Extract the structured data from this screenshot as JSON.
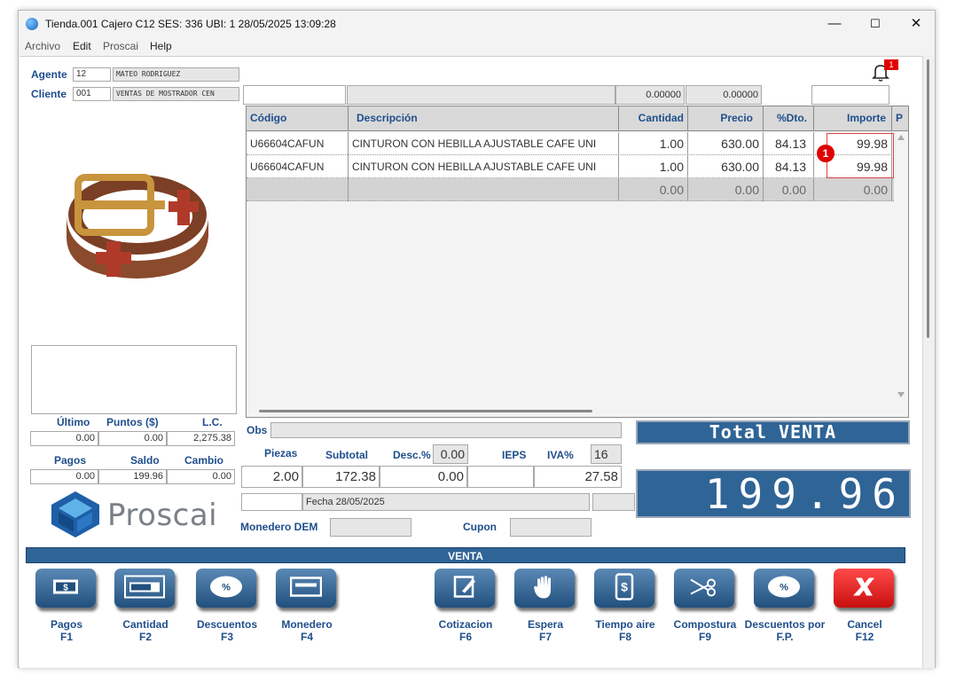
{
  "window": {
    "title": "Tienda.001  Cajero C12     SES: 336   UBI: 1   28/05/2025 13:09:28",
    "controls": {
      "minimize": "—",
      "maximize": "☐",
      "close": "✕"
    }
  },
  "menu": {
    "items": [
      "Archivo",
      "Edit",
      "Proscai",
      "Help"
    ]
  },
  "notification": {
    "count": "1"
  },
  "agent": {
    "label": "Agente",
    "code": "12",
    "name": "MATEO RODRIGUEZ"
  },
  "client": {
    "label": "Cliente",
    "code": "001",
    "name": "VENTAS DE MOSTRADOR CEN"
  },
  "grid_filters": {
    "qty_total": "0.00000",
    "price_total": "0.00000"
  },
  "grid": {
    "headers": [
      "Código",
      "Descripción",
      "Cantidad",
      "Precio",
      "%Dto.",
      "Importe",
      "P"
    ],
    "rows": [
      {
        "codigo": "U66604CAFUN",
        "descripcion": "CINTURON CON HEBILLA AJUSTABLE CAFE UNI",
        "cantidad": "1.00",
        "precio": "630.00",
        "dto": "84.13",
        "importe": "99.98"
      },
      {
        "codigo": "U66604CAFUN",
        "descripcion": "CINTURON CON HEBILLA AJUSTABLE CAFE UNI",
        "cantidad": "1.00",
        "precio": "630.00",
        "dto": "84.13",
        "importe": "99.98"
      }
    ],
    "totals": {
      "cantidad": "0.00",
      "precio": "0.00",
      "dto": "0.00",
      "importe": "0.00"
    },
    "badge": "1"
  },
  "points": {
    "headers": [
      "Último",
      "Puntos ($)",
      "L.C."
    ],
    "values": [
      "0.00",
      "0.00",
      "2,275.38"
    ],
    "headers2": [
      "Pagos",
      "Saldo",
      "Cambio"
    ],
    "values2": [
      "0.00",
      "199.96",
      "0.00"
    ]
  },
  "logo": {
    "text": "Proscai"
  },
  "summary": {
    "obs_label": "Obs",
    "piezas_label": "Piezas",
    "piezas": "2.00",
    "subtotal_label": "Subtotal",
    "subtotal": "172.38",
    "desc_label": "Desc.%",
    "desc_pct": "0.00",
    "desc": "0.00",
    "ieps_label": "IEPS",
    "ieps": "",
    "iva_label": "IVA%",
    "iva_pct": "16",
    "iva": "27.58",
    "fecha": "Fecha 28/05/2025",
    "monedero_label": "Monedero DEM",
    "cupon_label": "Cupon"
  },
  "total": {
    "label": "Total VENTA",
    "value": "199.96"
  },
  "mode_bar": "VENTA",
  "buttons": [
    {
      "label": "Pagos",
      "key": "F1",
      "icon": "cash-icon"
    },
    {
      "label": "Cantidad",
      "key": "F2",
      "icon": "calculator-icon"
    },
    {
      "label": "Descuentos",
      "key": "F3",
      "icon": "discount-icon"
    },
    {
      "label": "Monedero",
      "key": "F4",
      "icon": "card-icon"
    },
    {
      "label": "Cotizacion",
      "key": "F6",
      "icon": "quote-icon"
    },
    {
      "label": "Espera",
      "key": "F7",
      "icon": "hand-icon"
    },
    {
      "label": "Tiempo aire",
      "key": "F8",
      "icon": "phone-icon"
    },
    {
      "label": "Compostura",
      "key": "F9",
      "icon": "scissors-icon"
    },
    {
      "label": "Descuentos por",
      "key": "F.P.",
      "icon": "discount-fp-icon"
    },
    {
      "label": "Cancel",
      "key": "F12",
      "icon": "cancel-icon"
    }
  ],
  "colors": {
    "accent": "#2f6496",
    "label": "#1f4e8c",
    "cancel": "#d11b1b",
    "badge": "#e00000"
  }
}
